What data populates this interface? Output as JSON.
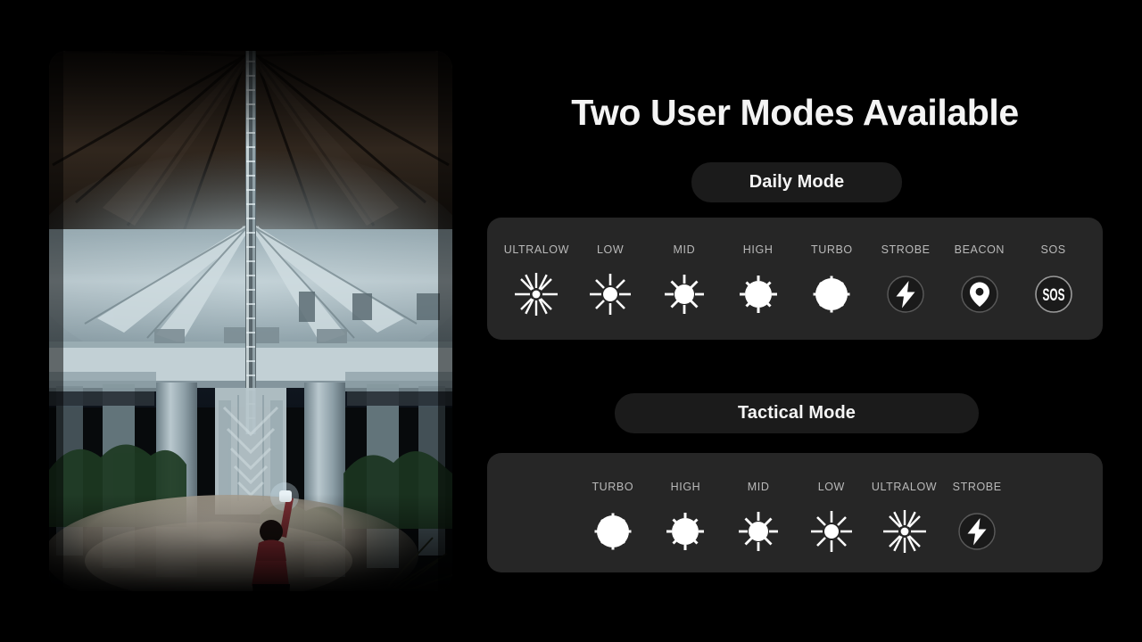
{
  "headline": "Two User Modes Available",
  "colors": {
    "background": "#000000",
    "panel": "#262626",
    "button": "#1b1b1b",
    "label": "#b9b9b9",
    "icon": "#ffffff",
    "title": "#f4f4f4"
  },
  "photo": {
    "alt_description": "Person in a red shirt standing at night under a concrete highway overpass, raising a flashlight whose beam illuminates the bridge underside and a vertical maintenance ladder",
    "subject": "flashlight-beam-under-bridge"
  },
  "daily": {
    "button_label": "Daily Mode",
    "modes": [
      {
        "label": "ULTRALOW",
        "icon": "sun-rays-xsmall-icon",
        "level": 1
      },
      {
        "label": "LOW",
        "icon": "sun-rays-small-icon",
        "level": 2
      },
      {
        "label": "MID",
        "icon": "sun-rays-medium-icon",
        "level": 3
      },
      {
        "label": "HIGH",
        "icon": "sun-rays-large-icon",
        "level": 4
      },
      {
        "label": "TURBO",
        "icon": "sun-solid-icon",
        "level": 5
      },
      {
        "label": "STROBE",
        "icon": "lightning-bolt-icon",
        "level": 0
      },
      {
        "label": "BEACON",
        "icon": "location-pin-icon",
        "level": 0
      },
      {
        "label": "SOS",
        "icon": "sos-icon",
        "level": 0
      }
    ]
  },
  "tactical": {
    "button_label": "Tactical Mode",
    "modes": [
      {
        "label": "TURBO",
        "icon": "sun-solid-icon",
        "level": 5
      },
      {
        "label": "HIGH",
        "icon": "sun-rays-large-icon",
        "level": 4
      },
      {
        "label": "MID",
        "icon": "sun-rays-medium-icon",
        "level": 3
      },
      {
        "label": "LOW",
        "icon": "sun-rays-small-icon",
        "level": 2
      },
      {
        "label": "ULTRALOW",
        "icon": "sun-rays-xsmall-icon",
        "level": 1
      },
      {
        "label": "STROBE",
        "icon": "lightning-bolt-icon",
        "level": 0
      }
    ]
  }
}
